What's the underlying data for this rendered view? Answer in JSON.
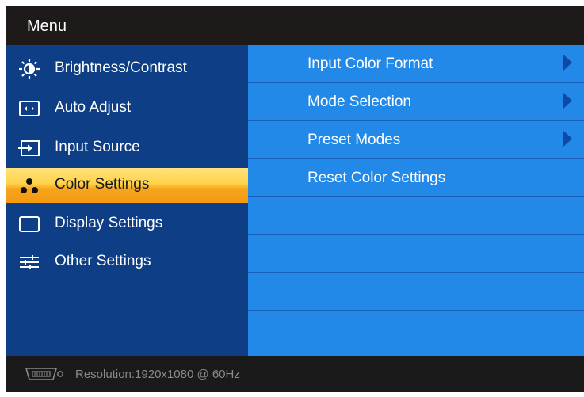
{
  "title": "Menu",
  "colors": {
    "left_panel": "#0d3e86",
    "right_panel": "#2389e8",
    "selected": "#f7a51c",
    "titlebar": "#1e1a1a",
    "footer_text": "#8a8a8a"
  },
  "left_menu": [
    {
      "label": "Brightness/Contrast",
      "icon": "brightness-icon"
    },
    {
      "label": "Auto Adjust",
      "icon": "auto-adjust-icon"
    },
    {
      "label": "Input Source",
      "icon": "input-source-icon"
    },
    {
      "label": "Color Settings",
      "icon": "color-settings-icon",
      "selected": true
    },
    {
      "label": "Display Settings",
      "icon": "display-settings-icon"
    },
    {
      "label": "Other Settings",
      "icon": "other-settings-icon"
    }
  ],
  "right_menu": [
    {
      "label": "Input Color Format",
      "has_submenu": true
    },
    {
      "label": "Mode Selection",
      "has_submenu": true
    },
    {
      "label": "Preset Modes",
      "has_submenu": true
    },
    {
      "label": "Reset Color Settings",
      "has_submenu": false
    },
    {
      "label": ""
    },
    {
      "label": ""
    },
    {
      "label": ""
    },
    {
      "label": ""
    }
  ],
  "footer": {
    "resolution": "Resolution:1920x1080 @ 60Hz",
    "icon": "vga-connector-icon"
  }
}
